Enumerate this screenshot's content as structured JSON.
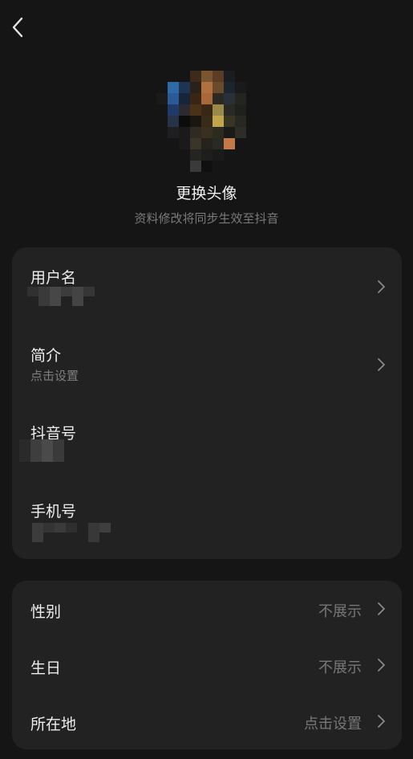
{
  "header": {
    "back_icon": "chevron-left-icon"
  },
  "profile": {
    "change_avatar_label": "更换头像",
    "sync_note": "资料修改将同步生效至抖音"
  },
  "card_main": {
    "items": [
      {
        "label": "用户名",
        "value": "",
        "value_hidden": true
      },
      {
        "label": "简介",
        "value": "点击设置"
      },
      {
        "label": "抖音号",
        "value": "",
        "value_hidden": true
      },
      {
        "label": "手机号",
        "value": "",
        "value_hidden": true
      }
    ]
  },
  "card_details": {
    "items": [
      {
        "label": "性别",
        "value": "不展示"
      },
      {
        "label": "生日",
        "value": "不展示"
      },
      {
        "label": "所在地",
        "value": "点击设置"
      }
    ]
  },
  "colors": {
    "background": "#151515",
    "card": "#222222",
    "primary_text": "#ededed",
    "secondary_text": "#7f7f7f"
  }
}
